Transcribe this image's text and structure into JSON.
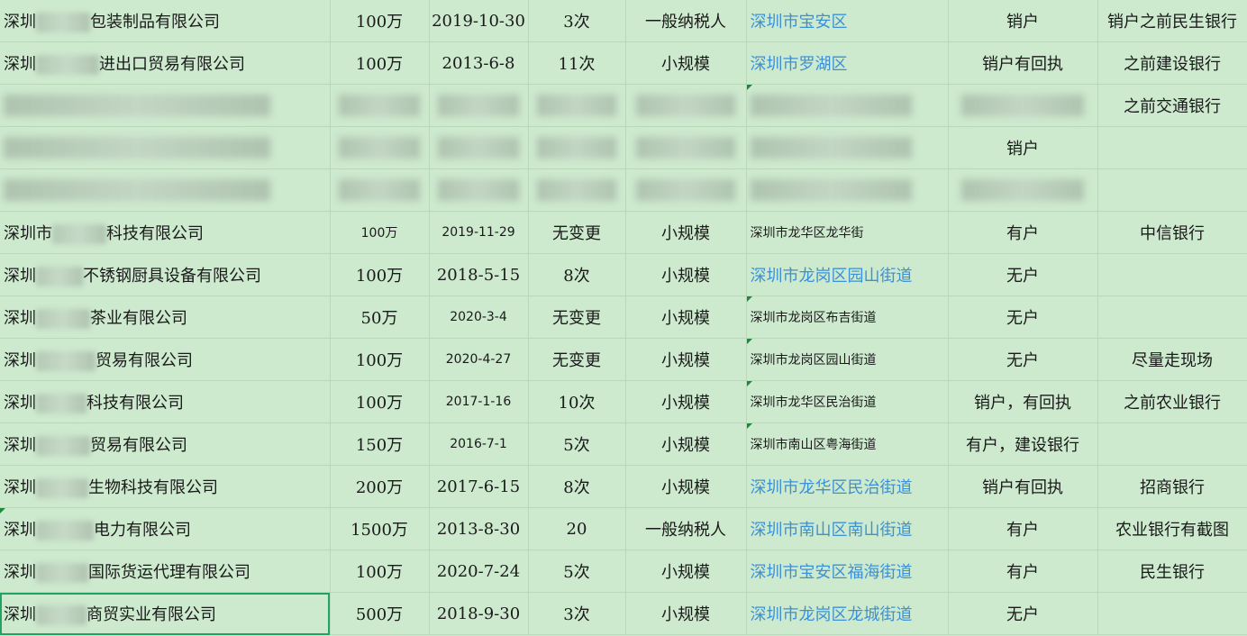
{
  "rows": [
    {
      "c0a": "深圳",
      "c0b": "包装制品有限公司",
      "c1": "100万",
      "c2": "2019-10-30",
      "c3": "3次",
      "c4": "一般纳税人",
      "c5": "深圳市宝安区",
      "c5link": true,
      "c6": "销户",
      "c7": "销户之前民生银行"
    },
    {
      "c0a": "深圳",
      "c0b": "进出口贸易有限公司",
      "c1": "100万",
      "c2": "2013-6-8",
      "c3": "11次",
      "c4": "小规模",
      "c5": "深圳市罗湖区",
      "c5link": true,
      "c6": "销户有回执",
      "c7": "之前建设银行"
    },
    {
      "blurred": true,
      "c7": "之前交通银行"
    },
    {
      "blurred": true,
      "c6": "销户",
      "c7": ""
    },
    {
      "blurred": true,
      "c7": ""
    },
    {
      "c0a": "深圳市",
      "c0b": "科技有限公司",
      "c1": "100万",
      "c2": "2019-11-29",
      "c3": "无变更",
      "c4": "小规模",
      "c5": "深圳市龙华区龙华街",
      "c5small": true,
      "c6": "有户",
      "c7": "中信银行"
    },
    {
      "c0a": "深圳",
      "c0b": "不锈钢厨具设备有限公司",
      "c1": "100万",
      "c2": "2018-5-15",
      "c3": "8次",
      "c4": "小规模",
      "c5": "深圳市龙岗区园山街道",
      "c5link": true,
      "c6": "无户",
      "c7": ""
    },
    {
      "c0a": "深圳",
      "c0b": "茶业有限公司",
      "c1": "50万",
      "c2": "2020-3-4",
      "c3": "无变更",
      "c4": "小规模",
      "c5": "深圳市龙岗区布吉街道",
      "c5small": true,
      "c6": "无户",
      "c7": ""
    },
    {
      "c0a": "深圳",
      "c0b": "贸易有限公司",
      "c1": "100万",
      "c2": "2020-4-27",
      "c3": "无变更",
      "c4": "小规模",
      "c5": "深圳市龙岗区园山街道",
      "c5small": true,
      "c6": "无户",
      "c7": "尽量走现场"
    },
    {
      "c0a": "深圳",
      "c0b": "科技有限公司",
      "c1": "100万",
      "c2": "2017-1-16",
      "c3": "10次",
      "c4": "小规模",
      "c5": "深圳市龙华区民治街道",
      "c5small": true,
      "c6": "销户，有回执",
      "c7": "之前农业银行"
    },
    {
      "c0a": "深圳",
      "c0b": "贸易有限公司",
      "c1": "150万",
      "c2": "2016-7-1",
      "c3": "5次",
      "c4": "小规模",
      "c5": "深圳市南山区粤海街道",
      "c5small": true,
      "c6": "有户，建设银行",
      "c7": ""
    },
    {
      "c0a": "深圳",
      "c0b": "生物科技有限公司",
      "c1": "200万",
      "c2": "2017-6-15",
      "c3": "8次",
      "c4": "小规模",
      "c5": "深圳市龙华区民治街道",
      "c5link": true,
      "c6": "销户有回执",
      "c7": "招商银行"
    },
    {
      "c0a": "深圳",
      "c0b": "电力有限公司",
      "c1": "1500万",
      "c2": "2013-8-30",
      "c3": "20",
      "c4": "一般纳税人",
      "c5": "深圳市南山区南山街道",
      "c5link": true,
      "c6": "有户",
      "c7": "农业银行有截图"
    },
    {
      "c0a": "深圳",
      "c0b": "国际货运代理有限公司",
      "c1": "100万",
      "c2": "2020-7-24",
      "c3": "5次",
      "c4": "小规模",
      "c5": "深圳市宝安区福海街道",
      "c5link": true,
      "c6": "有户",
      "c7": "民生银行"
    },
    {
      "c0a": "深圳",
      "c0b": "商贸实业有限公司",
      "c1": "500万",
      "c2": "2018-9-30",
      "c3": "3次",
      "c4": "小规模",
      "c5": "深圳市龙岗区龙城街道",
      "c5link": true,
      "c6": "无户",
      "c7": ""
    }
  ],
  "blurred_row_texts": {
    "r2": {
      "c3": "无变更",
      "c4": "小规模",
      "c5": "深圳市龙岗区横岗街道"
    },
    "r3": {
      "c1": "200万",
      "c2": "2018-6-16",
      "c3": "无变更",
      "c4": "小规模",
      "c5": "深圳市龙岗区横岗街道"
    },
    "r4": {
      "c2": "2017-8-23",
      "c3": "无变更"
    }
  },
  "colors": {
    "cell_bg": "#cde9ce",
    "grid": "#b9d8bb",
    "link": "#3b91d6",
    "selection": "#21a366"
  }
}
